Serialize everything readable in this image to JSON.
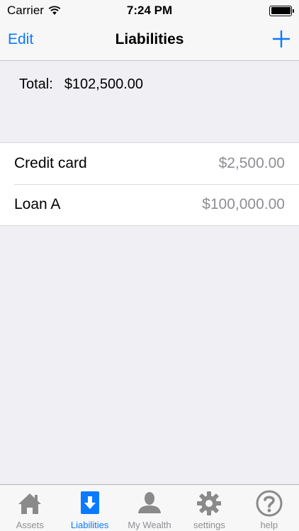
{
  "status_bar": {
    "carrier": "Carrier",
    "time": "7:24 PM"
  },
  "nav": {
    "edit_label": "Edit",
    "title": "Liabilities"
  },
  "summary": {
    "total_label": "Total:",
    "total_value": "$102,500.00"
  },
  "liabilities": [
    {
      "name": "Credit card",
      "amount": "$2,500.00"
    },
    {
      "name": "Loan A",
      "amount": "$100,000.00"
    }
  ],
  "tabs": [
    {
      "label": "Assets",
      "icon": "house-icon",
      "active": false
    },
    {
      "label": "Liabilities",
      "icon": "down-arrow-icon",
      "active": true
    },
    {
      "label": "My Wealth",
      "icon": "person-icon",
      "active": false
    },
    {
      "label": "settings",
      "icon": "gear-icon",
      "active": false
    },
    {
      "label": "help",
      "icon": "question-icon",
      "active": false
    }
  ],
  "colors": {
    "accent": "#0a7aff",
    "inactive": "#8e8e93",
    "background": "#efeff4"
  }
}
